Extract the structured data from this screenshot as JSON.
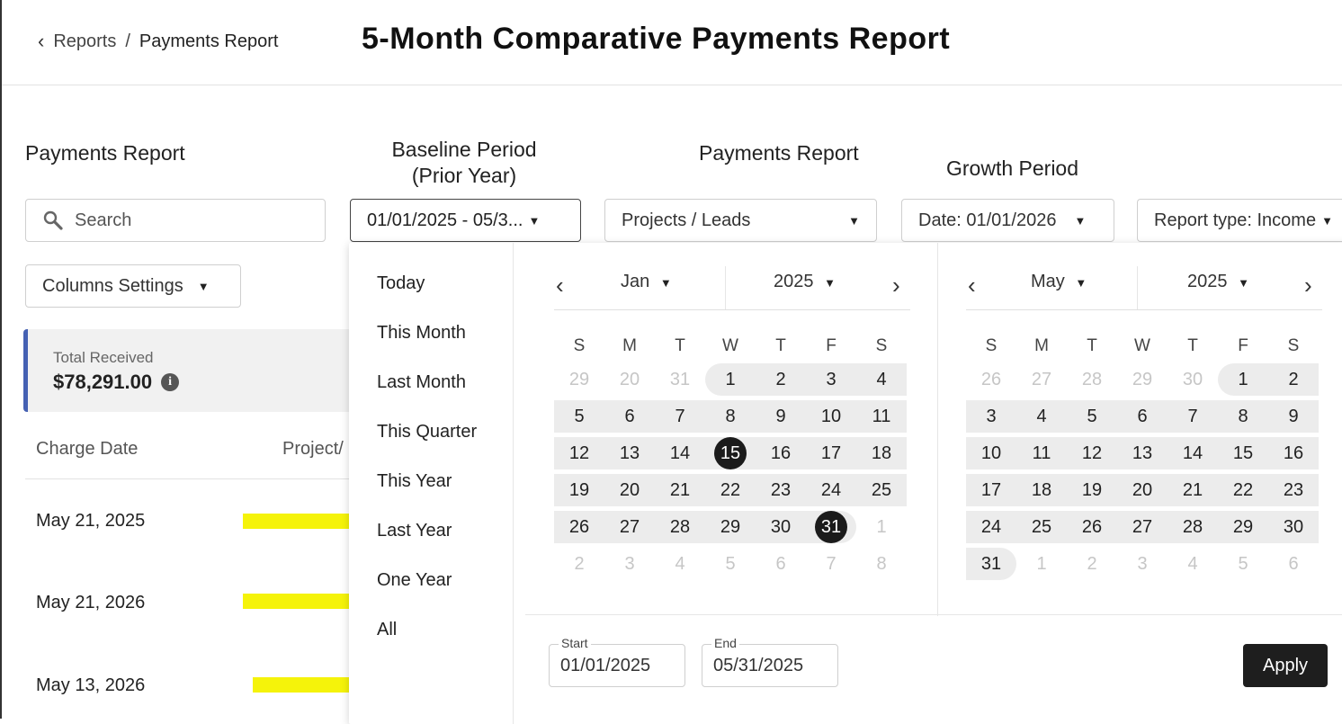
{
  "breadcrumb": {
    "back_icon": "chevron-left-icon",
    "parent": "Reports",
    "separator": "/",
    "current": "Payments Report"
  },
  "page_title": "5-Month Comparative Payments Report",
  "labels": {
    "payments_report": "Payments Report",
    "baseline_line1": "Baseline Period",
    "baseline_line2": "(Prior Year)",
    "payments_report_2": "Payments Report",
    "growth_period": "Growth Period"
  },
  "search": {
    "placeholder": "Search",
    "icon": "search-icon"
  },
  "filters": {
    "baseline_range": "01/01/2025 - 05/3...",
    "projects_leads": "Projects / Leads",
    "date": "Date: 01/01/2026",
    "report_type": "Report type: Income"
  },
  "columns_settings": "Columns Settings",
  "total": {
    "label": "Total Received",
    "value": "$78,291.00"
  },
  "table": {
    "columns": [
      "Charge Date",
      "Project/"
    ],
    "rows": [
      {
        "date": "May 21, 2025"
      },
      {
        "date": "May 21, 2026"
      },
      {
        "date": "May 13, 2026"
      }
    ]
  },
  "presets": [
    "Today",
    "This Month",
    "Last Month",
    "This Quarter",
    "This Year",
    "Last Year",
    "One Year",
    "All"
  ],
  "weekdays": [
    "S",
    "M",
    "T",
    "W",
    "T",
    "F",
    "S"
  ],
  "calendars": [
    {
      "month": "Jan",
      "year": "2025",
      "weeks": [
        [
          "29",
          "20",
          "31",
          "1",
          "2",
          "3",
          "4"
        ],
        [
          "5",
          "6",
          "7",
          "8",
          "9",
          "10",
          "11"
        ],
        [
          "12",
          "13",
          "14",
          "15",
          "16",
          "17",
          "18"
        ],
        [
          "19",
          "20",
          "21",
          "22",
          "23",
          "24",
          "25"
        ],
        [
          "26",
          "27",
          "28",
          "29",
          "30",
          "31",
          "1"
        ],
        [
          "2",
          "3",
          "4",
          "5",
          "6",
          "7",
          "8"
        ]
      ],
      "out_of_month": [
        [
          0,
          0
        ],
        [
          0,
          1
        ],
        [
          0,
          2
        ],
        [
          4,
          6
        ],
        [
          5,
          0
        ],
        [
          5,
          1
        ],
        [
          5,
          2
        ],
        [
          5,
          3
        ],
        [
          5,
          4
        ],
        [
          5,
          5
        ],
        [
          5,
          6
        ]
      ],
      "selected": [
        [
          2,
          3
        ],
        [
          4,
          5
        ]
      ],
      "range_start": [
        0,
        3
      ],
      "range_end": [
        4,
        5
      ]
    },
    {
      "month": "May",
      "year": "2025",
      "weeks": [
        [
          "26",
          "27",
          "28",
          "29",
          "30",
          "1",
          "2"
        ],
        [
          "3",
          "4",
          "5",
          "6",
          "7",
          "8",
          "9"
        ],
        [
          "10",
          "11",
          "12",
          "13",
          "14",
          "15",
          "16"
        ],
        [
          "17",
          "18",
          "19",
          "20",
          "21",
          "22",
          "23"
        ],
        [
          "24",
          "25",
          "26",
          "27",
          "28",
          "29",
          "30"
        ],
        [
          "31",
          "1",
          "2",
          "3",
          "4",
          "5",
          "6"
        ]
      ],
      "out_of_month": [
        [
          0,
          0
        ],
        [
          0,
          1
        ],
        [
          0,
          2
        ],
        [
          0,
          3
        ],
        [
          0,
          4
        ],
        [
          5,
          1
        ],
        [
          5,
          2
        ],
        [
          5,
          3
        ],
        [
          5,
          4
        ],
        [
          5,
          5
        ],
        [
          5,
          6
        ]
      ],
      "selected": [],
      "range_start": [
        0,
        5
      ],
      "range_end": [
        5,
        0
      ]
    }
  ],
  "footer": {
    "start_label": "Start",
    "start_value": "01/01/2025",
    "end_label": "End",
    "end_value": "05/31/2025",
    "apply": "Apply"
  },
  "colors": {
    "accent_bar": "#4561b3",
    "highlight": "#f5f30a",
    "selected_day": "#1b1b1b",
    "range_bg": "#ececec"
  }
}
